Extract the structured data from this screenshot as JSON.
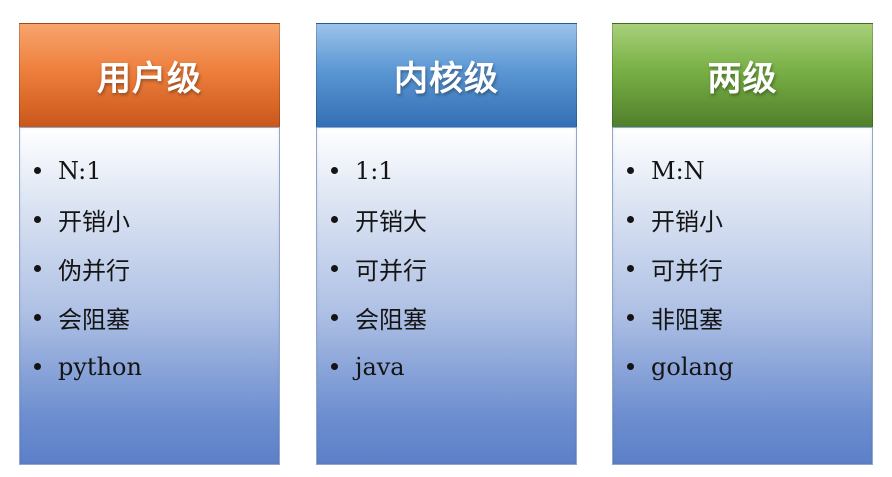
{
  "columns": [
    {
      "title": "用户级",
      "header_color": "#ee7f3d",
      "items": [
        "N:1",
        "开销小",
        "伪并行",
        "会阻塞",
        "python"
      ]
    },
    {
      "title": "内核级",
      "header_color": "#5b97d4",
      "items": [
        "1:1",
        "开销大",
        "可并行",
        "会阻塞",
        "java"
      ]
    },
    {
      "title": "两级",
      "header_color": "#78b045",
      "items": [
        "M:N",
        "开销小",
        "可并行",
        "非阻塞",
        "golang"
      ]
    }
  ]
}
